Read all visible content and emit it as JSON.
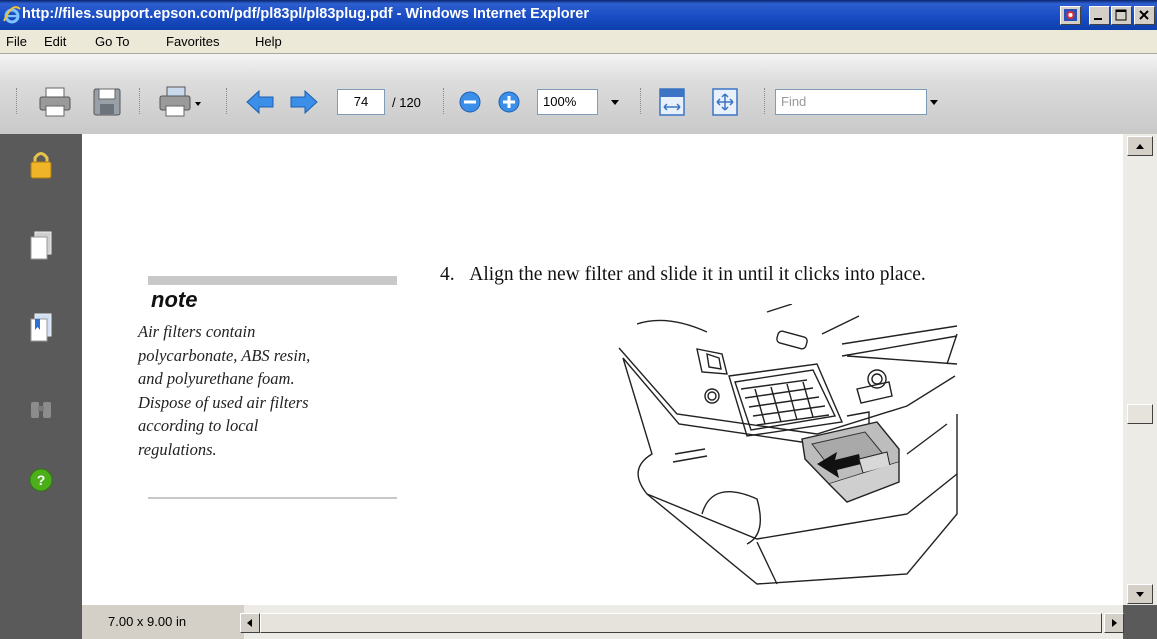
{
  "window": {
    "title": "http://files.support.epson.com/pdf/pl83pl/pl83plug.pdf - Windows Internet Explorer",
    "title_icon": "ie-logo-icon",
    "caption_icons": [
      "custom-status-icon",
      "minimize-icon",
      "maximize-icon",
      "close-icon"
    ]
  },
  "menu": [
    "File",
    "Edit",
    "Go To",
    "Favorites",
    "Help"
  ],
  "toolbar": {
    "page_number": "74",
    "page_total": "/ 120",
    "zoom_value": "100%",
    "find_placeholder": "Find",
    "icons": [
      "print-icon",
      "save-icon",
      "markup-tool-icon",
      "previous-page-icon",
      "next-page-icon",
      "zoom-out-icon",
      "zoom-in-icon",
      "fit-width-icon",
      "fit-page-icon"
    ]
  },
  "nav_panel": {
    "icons": [
      "security-lock-icon",
      "pages-icon",
      "bookmarks-icon",
      "search-binoculars-icon",
      "help-icon"
    ]
  },
  "document": {
    "note_title": "note",
    "note_lines": [
      "Air filters contain",
      "polycarbonate, ABS resin,",
      "and polyurethane foam.",
      "Dispose of used air filters",
      "according to local",
      "regulations."
    ],
    "step_number": "4.",
    "step_text": "Align the new filter and slide it in until it clicks into place.",
    "illustration": "projector-air-filter-insertion-drawing"
  },
  "status": {
    "page_size": "7.00 x 9.00 in"
  },
  "colors": {
    "title_bar": "#1a4cc4",
    "nav_panel": "#5a5a5a",
    "help_icon": "#4caf1a",
    "arrow_icon": "#3b8fe8"
  }
}
